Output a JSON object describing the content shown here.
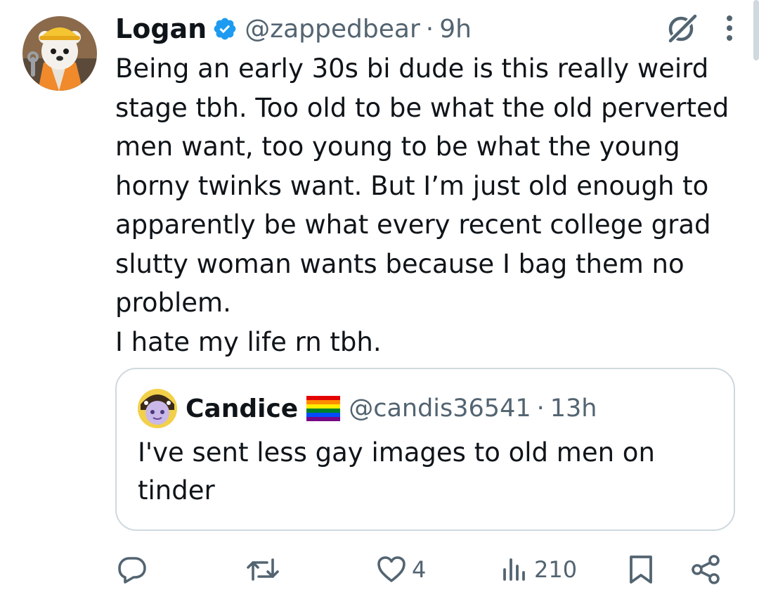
{
  "tweet": {
    "author": {
      "name": "Logan",
      "handle": "@zappedbear",
      "verified": true,
      "avatar_icon": "bear-avatar-icon"
    },
    "separator": "·",
    "time": "9h",
    "text": "Being an early 30s bi dude is this really weird stage tbh. Too old to be what the old perverted men want, too young to be what the young horny twinks want. But I’m just old enough to apparently be what every recent college grad slutty woman wants because I bag them no problem.\nI hate my life rn tbh.",
    "top_icons": [
      "grok-icon",
      "more-icon"
    ]
  },
  "quote": {
    "author": {
      "name": "Candice",
      "handle": "@candis36541",
      "flag_icon": "rainbow-flag-icon",
      "avatar_icon": "candice-avatar-icon"
    },
    "separator": "·",
    "time": "13h",
    "text": "I've sent less gay images to old men on tinder"
  },
  "actions": {
    "reply": {
      "icon": "reply-icon"
    },
    "retweet": {
      "icon": "retweet-icon"
    },
    "like": {
      "icon": "heart-icon",
      "count": "4"
    },
    "views": {
      "icon": "views-icon",
      "count": "210"
    },
    "bookmark": {
      "icon": "bookmark-icon"
    },
    "share": {
      "icon": "share-icon"
    }
  },
  "colors": {
    "text_primary": "#0f1419",
    "text_secondary": "#536471",
    "verified": "#1d9bf0",
    "border": "#cfd9de"
  }
}
